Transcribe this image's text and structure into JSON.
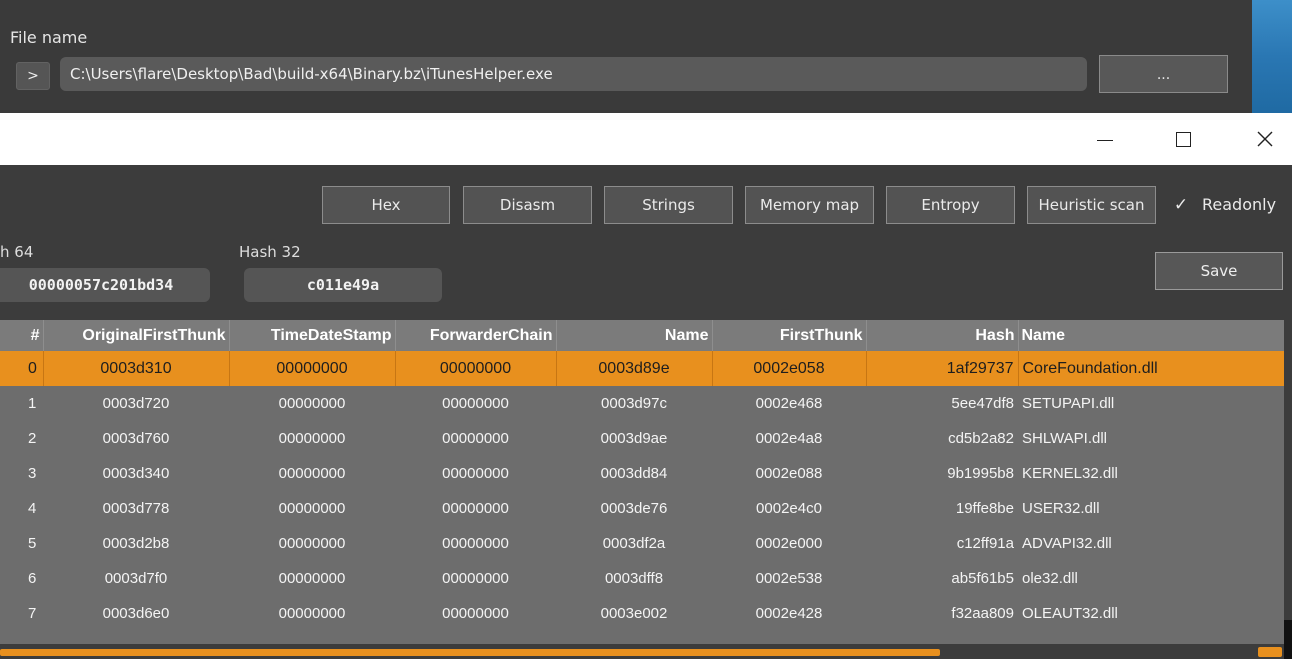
{
  "file": {
    "label": "File name",
    "prompt_label": ">",
    "path": "C:\\Users\\flare\\Desktop\\Bad\\build-x64\\Binary.bz\\iTunesHelper.exe",
    "browse_label": "..."
  },
  "window": {
    "close_glyph": "✕"
  },
  "toolbar": {
    "buttons": [
      "Hex",
      "Disasm",
      "Strings",
      "Memory map",
      "Entropy",
      "Heuristic scan"
    ],
    "readonly_check": "✓",
    "readonly_label": "Readonly",
    "readonly_checked": true
  },
  "hashes": {
    "hash64_label": "h 64",
    "hash64_value": "00000057c201bd34",
    "hash32_label": "Hash 32",
    "hash32_value": "c011e49a",
    "save_label": "Save"
  },
  "table": {
    "columns": [
      "#",
      "OriginalFirstThunk",
      "TimeDateStamp",
      "ForwarderChain",
      "Name",
      "FirstThunk",
      "Hash",
      "Name"
    ],
    "selected_row": 0,
    "rows": [
      [
        "0",
        "0003d310",
        "00000000",
        "00000000",
        "0003d89e",
        "0002e058",
        "1af29737",
        "CoreFoundation.dll"
      ],
      [
        "1",
        "0003d720",
        "00000000",
        "00000000",
        "0003d97c",
        "0002e468",
        "5ee47df8",
        "SETUPAPI.dll"
      ],
      [
        "2",
        "0003d760",
        "00000000",
        "00000000",
        "0003d9ae",
        "0002e4a8",
        "cd5b2a82",
        "SHLWAPI.dll"
      ],
      [
        "3",
        "0003d340",
        "00000000",
        "00000000",
        "0003dd84",
        "0002e088",
        "9b1995b8",
        "KERNEL32.dll"
      ],
      [
        "4",
        "0003d778",
        "00000000",
        "00000000",
        "0003de76",
        "0002e4c0",
        "19ffe8be",
        "USER32.dll"
      ],
      [
        "5",
        "0003d2b8",
        "00000000",
        "00000000",
        "0003df2a",
        "0002e000",
        "c12ff91a",
        "ADVAPI32.dll"
      ],
      [
        "6",
        "0003d7f0",
        "00000000",
        "00000000",
        "0003dff8",
        "0002e538",
        "ab5f61b5",
        "ole32.dll"
      ],
      [
        "7",
        "0003d6e0",
        "00000000",
        "00000000",
        "0003e002",
        "0002e428",
        "f32aa809",
        "OLEAUT32.dll"
      ]
    ]
  },
  "colors": {
    "accent": "#e8901e",
    "panel": "#3c3c3c",
    "table": "#6d6d6d"
  }
}
